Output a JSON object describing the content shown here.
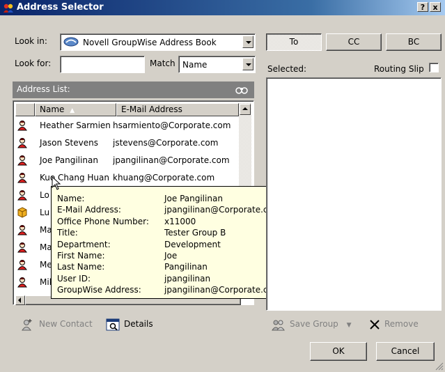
{
  "window": {
    "title": "Address Selector",
    "help_button": "?",
    "close_button": "x"
  },
  "lookin": {
    "label": "Look in:",
    "value": "Novell GroupWise Address Book"
  },
  "lookfor": {
    "label": "Look for:",
    "value": "",
    "match_label": "Match",
    "match_value": "Name"
  },
  "address_list": {
    "header": "Address List:",
    "columns": [
      "Name",
      "E-Mail Address"
    ],
    "rows": [
      {
        "name": "Heather Sarmien",
        "email": "hsarmiento@Corporate.com",
        "icon": "person-icon"
      },
      {
        "name": "Jason Stevens",
        "email": "jstevens@Corporate.com",
        "icon": "person-icon"
      },
      {
        "name": "Joe Pangilinan",
        "email": "jpangilinan@Corporate.com",
        "icon": "person-icon"
      },
      {
        "name": "Kuo Chang Huan",
        "email": "khuang@Corporate.com",
        "icon": "person-icon"
      },
      {
        "name": "Lo",
        "email": "",
        "icon": "person-icon"
      },
      {
        "name": "Lu",
        "email": "",
        "icon": "resource-icon"
      },
      {
        "name": "Ma",
        "email": "",
        "icon": "person-icon"
      },
      {
        "name": "Ma",
        "email": "",
        "icon": "person-icon"
      },
      {
        "name": "Me",
        "email": "",
        "icon": "person-icon"
      },
      {
        "name": "Mik",
        "email": "",
        "icon": "person-icon"
      }
    ]
  },
  "tooltip": {
    "fields": [
      {
        "key": "Name:",
        "value": "Joe Pangilinan"
      },
      {
        "key": "E-Mail Address:",
        "value": "jpangilinan@Corporate.com"
      },
      {
        "key": "Office Phone Number:",
        "value": "x11000"
      },
      {
        "key": "Title:",
        "value": "Tester Group B"
      },
      {
        "key": "Department:",
        "value": "Development"
      },
      {
        "key": "First Name:",
        "value": "Joe"
      },
      {
        "key": "Last Name:",
        "value": "Pangilinan"
      },
      {
        "key": "User ID:",
        "value": "jpangilinan"
      },
      {
        "key": "GroupWise Address:",
        "value": "jpangilinan@Corporate.com"
      }
    ]
  },
  "recipient_buttons": {
    "to": "To",
    "cc": "CC",
    "bc": "BC"
  },
  "selected": {
    "label": "Selected:",
    "routing_slip_label": "Routing Slip",
    "routing_slip_checked": false
  },
  "actions": {
    "new_contact": "New Contact",
    "details": "Details",
    "save_group": "Save Group",
    "remove": "Remove",
    "ok": "OK",
    "cancel": "Cancel"
  },
  "colors": {
    "titlebar_start": "#0a246a",
    "dialog_bg": "#d4d0c8",
    "tooltip_bg": "#ffffe1",
    "list_header_bg": "#808080"
  }
}
